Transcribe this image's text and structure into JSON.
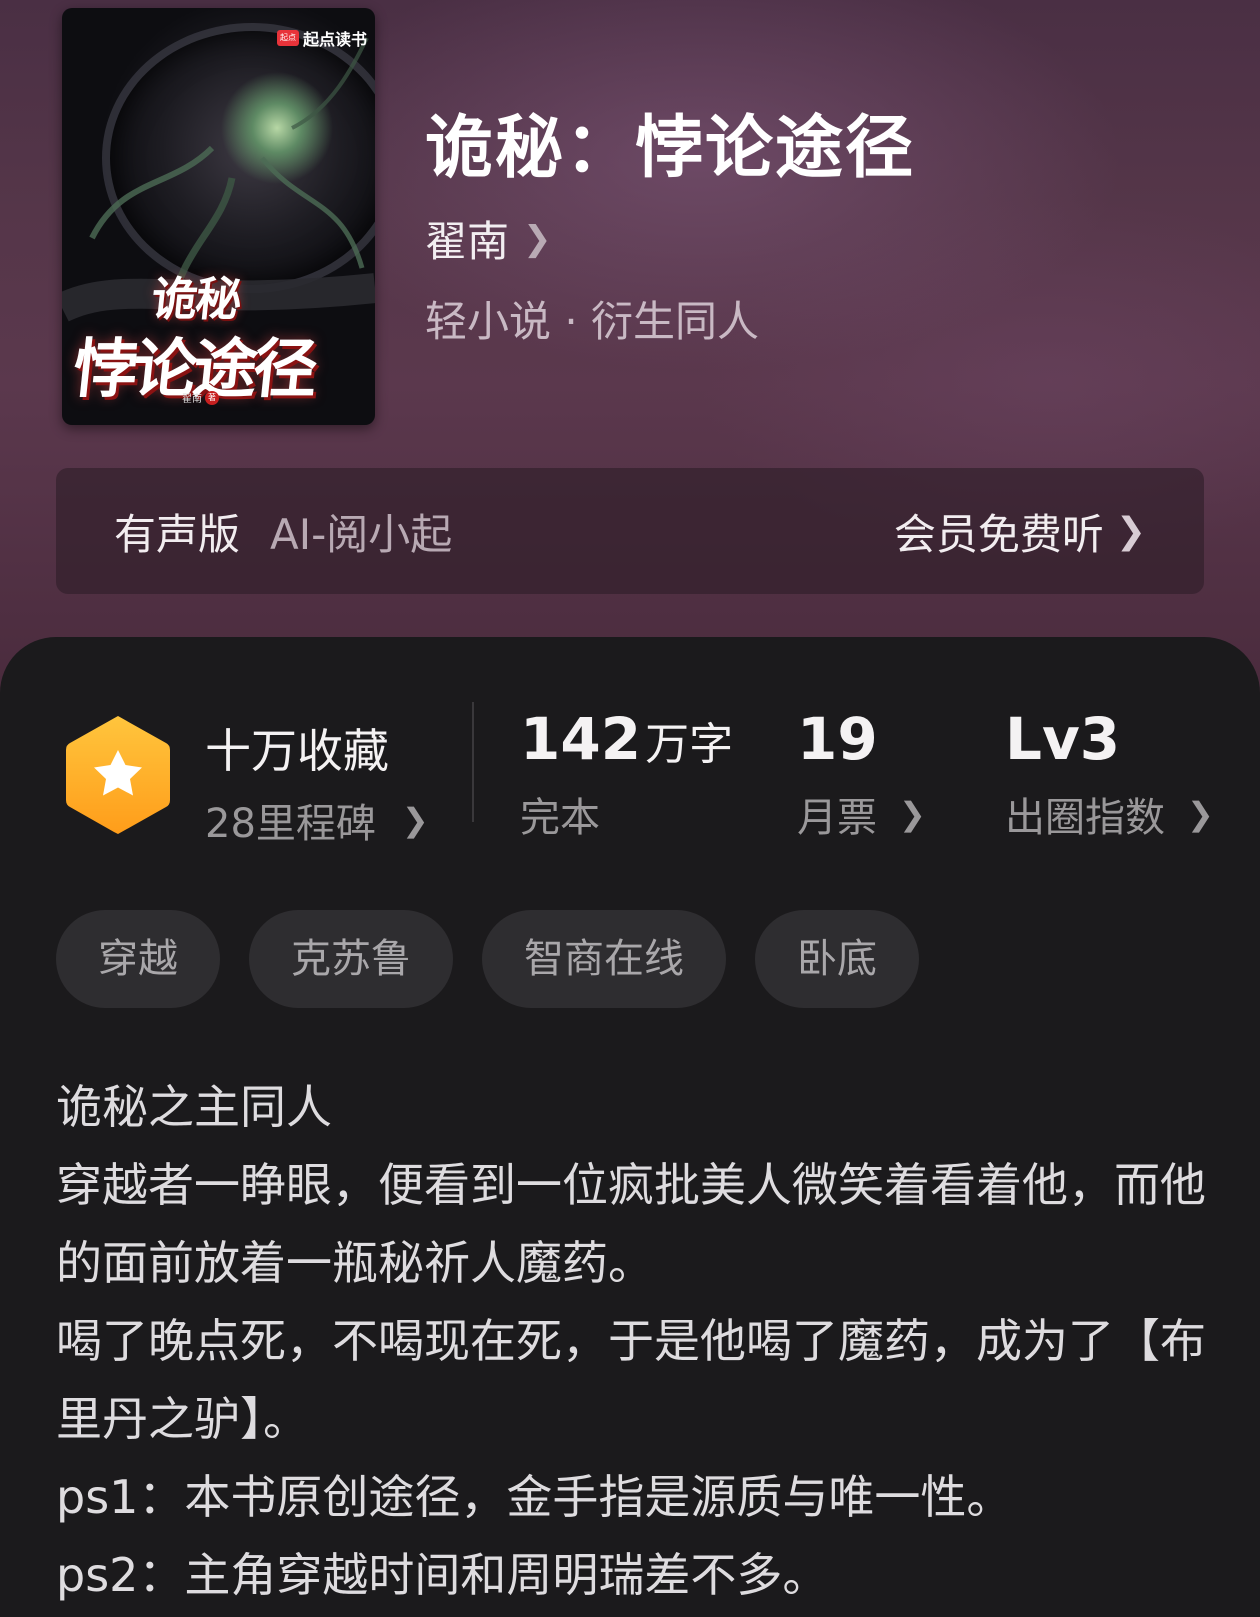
{
  "book": {
    "cover": {
      "publisher_badge": "起点",
      "publisher": "起点读书",
      "title_line1": "诡秘",
      "title_line2": "悖论途径",
      "author": "翟南",
      "author_mark": "著"
    },
    "title": "诡秘：悖论途径",
    "author": "翟南",
    "genre": "轻小说 · 衍生同人"
  },
  "audio": {
    "label": "有声版",
    "narrator": "AI-阅小起",
    "action": "会员免费听"
  },
  "stats": {
    "collect_title": "十万收藏",
    "milestone": "28里程碑",
    "words_number": "142",
    "words_unit": "万字",
    "words_status": "完本",
    "votes_number": "19",
    "votes_label": "月票",
    "level_value": "Lv3",
    "level_label": "出圈指数"
  },
  "tags": [
    "穿越",
    "克苏鲁",
    "智商在线",
    "卧底"
  ],
  "description": [
    "诡秘之主同人",
    "穿越者一睁眼，便看到一位疯批美人微笑着看着他，而他的面前放着一瓶秘祈人魔药。",
    "喝了晚点死，不喝现在死，于是他喝了魔药，成为了【布里丹之驴】。",
    "ps1：本书原创途径，金手指是源质与唯一性。",
    "ps2：主角穿越时间和周明瑞差不多。"
  ],
  "icons": {
    "badge": "star-hexagon-icon",
    "chevron": "chevron-right-icon"
  },
  "colors": {
    "badge_top": "#ffc53d",
    "badge_bottom": "#ff9d1a",
    "header": "#553649",
    "panel": "#1b1a1c"
  }
}
